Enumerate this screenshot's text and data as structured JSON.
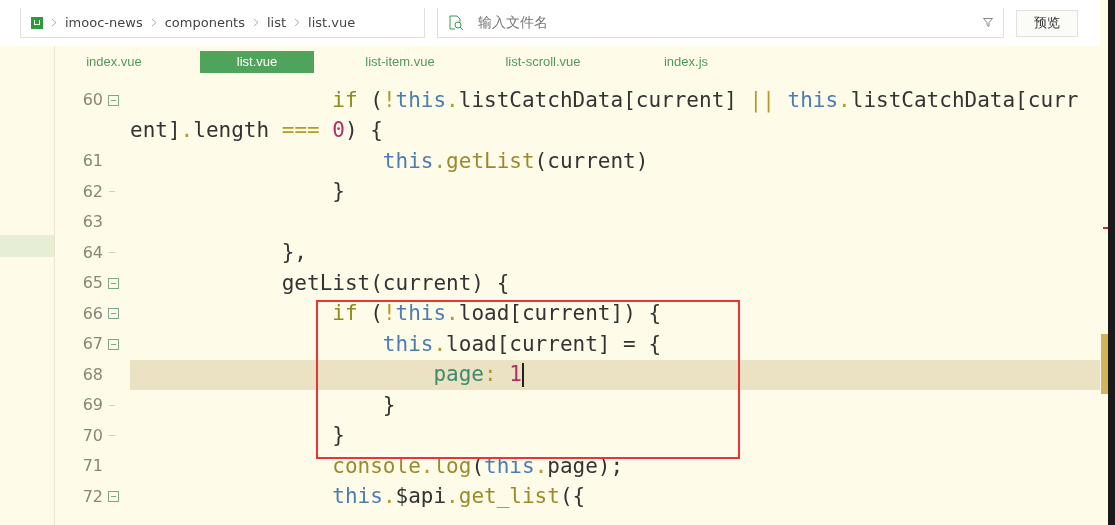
{
  "breadcrumb": [
    "imooc-news",
    "components",
    "list",
    "list.vue"
  ],
  "search": {
    "placeholder": "输入文件名"
  },
  "preview_button": "预览",
  "tabs": [
    {
      "label": "index.vue",
      "selected": false
    },
    {
      "label": "list.vue",
      "selected": true
    },
    {
      "label": "list-item.vue",
      "selected": false
    },
    {
      "label": "list-scroll.vue",
      "selected": false
    },
    {
      "label": "index.js",
      "selected": false
    }
  ],
  "code": [
    {
      "kind": "line",
      "number": "60",
      "fold_start": true,
      "fold_end": false,
      "current": false,
      "tokens": [
        {
          "kind": "kw",
          "s": "                if"
        },
        {
          "kind": "plain",
          "s": " ("
        },
        {
          "kind": "op",
          "s": "!"
        },
        {
          "kind": "this",
          "s": "this"
        },
        {
          "kind": "op",
          "s": "."
        },
        {
          "kind": "plain",
          "s": "listCatchData[current] "
        },
        {
          "kind": "op",
          "s": "||"
        },
        {
          "kind": "this",
          "s": " this"
        },
        {
          "kind": "op",
          "s": "."
        },
        {
          "kind": "plain",
          "s": "listCatchData[curr"
        }
      ]
    },
    {
      "kind": "wrap",
      "fold_start": false,
      "fold_end": false,
      "current": false,
      "tokens": [
        {
          "kind": "plain",
          "s": "ent]"
        },
        {
          "kind": "op",
          "s": "."
        },
        {
          "kind": "plain",
          "s": "length "
        },
        {
          "kind": "op",
          "s": "==="
        },
        {
          "kind": "num",
          "s": " 0"
        },
        {
          "kind": "plain",
          "s": ") {"
        }
      ]
    },
    {
      "kind": "line",
      "number": "61",
      "fold_start": false,
      "fold_end": false,
      "current": false,
      "tokens": [
        {
          "kind": "this",
          "s": "                    this"
        },
        {
          "kind": "op",
          "s": "."
        },
        {
          "kind": "fn",
          "s": "getList"
        },
        {
          "kind": "plain",
          "s": "(current)"
        }
      ]
    },
    {
      "kind": "line",
      "number": "62",
      "fold_start": false,
      "fold_end": true,
      "current": false,
      "tokens": [
        {
          "kind": "plain",
          "s": "                }"
        }
      ]
    },
    {
      "kind": "line",
      "number": "63",
      "fold_start": false,
      "fold_end": false,
      "current": false
    },
    {
      "kind": "line",
      "number": "64",
      "fold_start": false,
      "fold_end": true,
      "current": false,
      "tokens": [
        {
          "kind": "plain",
          "s": "            },"
        }
      ]
    },
    {
      "kind": "line",
      "number": "65",
      "fold_start": true,
      "fold_end": false,
      "current": false,
      "tokens": [
        {
          "kind": "plain",
          "s": "            getList(current) {"
        }
      ]
    },
    {
      "kind": "line",
      "number": "66",
      "fold_start": true,
      "fold_end": false,
      "current": false,
      "tokens": [
        {
          "kind": "kw",
          "s": "                if"
        },
        {
          "kind": "plain",
          "s": " ("
        },
        {
          "kind": "op",
          "s": "!"
        },
        {
          "kind": "this",
          "s": "this"
        },
        {
          "kind": "op",
          "s": "."
        },
        {
          "kind": "plain",
          "s": "load[current]) {"
        }
      ]
    },
    {
      "kind": "line",
      "number": "67",
      "fold_start": true,
      "fold_end": false,
      "current": false,
      "tokens": [
        {
          "kind": "this",
          "s": "                    this"
        },
        {
          "kind": "op",
          "s": "."
        },
        {
          "kind": "plain",
          "s": "load[current] = {"
        }
      ]
    },
    {
      "kind": "line",
      "number": "68",
      "fold_start": false,
      "fold_end": false,
      "current": true,
      "tokens": [
        {
          "kind": "prop",
          "s": "                        page"
        },
        {
          "kind": "op",
          "s": ":"
        },
        {
          "kind": "num",
          "s": " 1"
        }
      ]
    },
    {
      "kind": "line",
      "number": "69",
      "fold_start": false,
      "fold_end": true,
      "current": false,
      "tokens": [
        {
          "kind": "plain",
          "s": "                    }"
        }
      ]
    },
    {
      "kind": "line",
      "number": "70",
      "fold_start": false,
      "fold_end": true,
      "current": false,
      "tokens": [
        {
          "kind": "plain",
          "s": "                }"
        }
      ]
    },
    {
      "kind": "line",
      "number": "71",
      "fold_start": false,
      "fold_end": false,
      "current": false,
      "tokens": [
        {
          "kind": "fn",
          "s": "                console"
        },
        {
          "kind": "op",
          "s": "."
        },
        {
          "kind": "fn",
          "s": "log"
        },
        {
          "kind": "plain",
          "s": "("
        },
        {
          "kind": "this",
          "s": "this"
        },
        {
          "kind": "op",
          "s": "."
        },
        {
          "kind": "plain",
          "s": "page);"
        }
      ]
    },
    {
      "kind": "line",
      "number": "72",
      "fold_start": true,
      "fold_end": false,
      "current": false,
      "tokens": [
        {
          "kind": "this",
          "s": "                this"
        },
        {
          "kind": "op",
          "s": "."
        },
        {
          "kind": "plain",
          "s": "$api"
        },
        {
          "kind": "op",
          "s": "."
        },
        {
          "kind": "fn",
          "s": "get_list"
        },
        {
          "kind": "plain",
          "s": "({"
        }
      ]
    }
  ]
}
